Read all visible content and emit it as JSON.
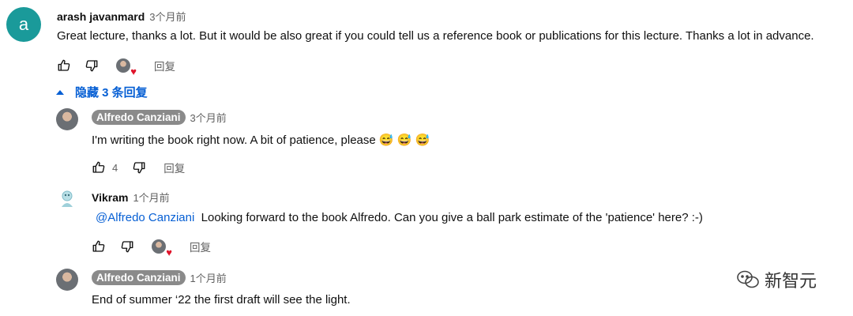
{
  "comment": {
    "avatar_letter": "a",
    "author": "arash javanmard",
    "time": "3个月前",
    "text": "Great lecture, thanks a lot. But it would be also great if you could tell us a reference book or publications for this lecture. Thanks a lot in advance.",
    "reply_label": "回复"
  },
  "toggle": {
    "label": "隐藏 3 条回复"
  },
  "replies": [
    {
      "author": "Alfredo Canziani",
      "time": "3个月前",
      "text": "I'm writing the book right now. A bit of patience, please 😅 😅 😅",
      "like_count": "4",
      "reply_label": "回复"
    },
    {
      "author": "Vikram",
      "time": "1个月前",
      "mention": "@Alfredo Canziani",
      "text": "Looking forward to the book Alfredo. Can you give a ball park estimate of the 'patience' here? :-)",
      "reply_label": "回复"
    },
    {
      "author": "Alfredo Canziani",
      "time": "1个月前",
      "text": "End of summer ‘22 the first draft will see the light."
    }
  ],
  "watermark": {
    "text": "新智元"
  },
  "colors": {
    "link": "#065fd4",
    "heart": "#e0142b",
    "avatar_bg": "#1a9a9a"
  }
}
